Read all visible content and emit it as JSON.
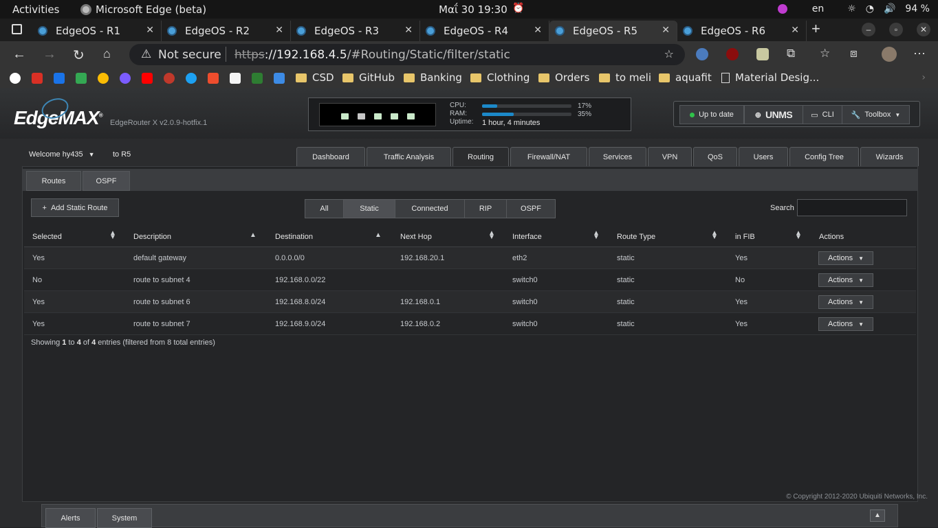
{
  "os_bar": {
    "activities": "Activities",
    "app_name": "Microsoft Edge (beta)",
    "clock": "Μαΐ 30  19:30",
    "lang": "en",
    "battery": "94 %"
  },
  "browser": {
    "tabs": [
      {
        "label": "EdgeOS - R1"
      },
      {
        "label": "EdgeOS - R2"
      },
      {
        "label": "EdgeOS - R3"
      },
      {
        "label": "EdgeOS - R4"
      },
      {
        "label": "EdgeOS - R5",
        "active": true
      },
      {
        "label": "EdgeOS - R6"
      }
    ],
    "not_secure": "Not secure",
    "url_scheme": "https",
    "url_host": "://192.168.4.5",
    "url_path": "/#Routing/Static/filter/static",
    "bookmarks": [
      "CSD",
      "GitHub",
      "Banking",
      "Clothing",
      "Orders",
      "to meli",
      "aquafit",
      "Material Desig..."
    ]
  },
  "router": {
    "logo": "EdgeMAX",
    "model": "EdgeRouter X v2.0.9-hotfix.1",
    "cpu_label": "CPU:",
    "ram_label": "RAM:",
    "uptime_label": "Uptime:",
    "cpu_pct": "17%",
    "cpu_value": 0.17,
    "ram_pct": "35%",
    "ram_value": 0.35,
    "uptime": "1 hour, 4 minutes",
    "update_status": "Up to date",
    "unms": "UNMS",
    "cli": "CLI",
    "toolbox": "Toolbox",
    "welcome": "Welcome hy435",
    "to_router": "to R5",
    "main_tabs": [
      "Dashboard",
      "Traffic Analysis",
      "Routing",
      "Firewall/NAT",
      "Services",
      "VPN",
      "QoS",
      "Users",
      "Config Tree",
      "Wizards"
    ],
    "sub_tabs": [
      "Routes",
      "OSPF"
    ],
    "add_route": "Add Static Route",
    "filters": [
      "All",
      "Static",
      "Connected",
      "RIP",
      "OSPF"
    ],
    "search_label": "Search",
    "columns": [
      "Selected",
      "Description",
      "Destination",
      "Next Hop",
      "Interface",
      "Route Type",
      "in FIB",
      "Actions"
    ],
    "rows": [
      {
        "selected": "Yes",
        "description": "default gateway",
        "destination": "0.0.0.0/0",
        "next_hop": "192.168.20.1",
        "interface": "eth2",
        "route_type": "static",
        "in_fib": "Yes",
        "action": "Actions"
      },
      {
        "selected": "No",
        "description": "route to subnet 4",
        "destination": "192.168.0.0/22",
        "next_hop": "",
        "interface": "switch0",
        "route_type": "static",
        "in_fib": "No",
        "action": "Actions"
      },
      {
        "selected": "Yes",
        "description": "route to subnet 6",
        "destination": "192.168.8.0/24",
        "next_hop": "192.168.0.1",
        "interface": "switch0",
        "route_type": "static",
        "in_fib": "Yes",
        "action": "Actions"
      },
      {
        "selected": "Yes",
        "description": "route to subnet 7",
        "destination": "192.168.9.0/24",
        "next_hop": "192.168.0.2",
        "interface": "switch0",
        "route_type": "static",
        "in_fib": "Yes",
        "action": "Actions"
      }
    ],
    "showing_prefix": "Showing ",
    "showing_from": "1",
    "showing_to_word": " to ",
    "showing_to": "4",
    "showing_of_word": " of ",
    "showing_total": "4",
    "showing_suffix": " entries (filtered from 8 total entries)",
    "copyright": "© Copyright 2012-2020 Ubiquiti Networks, Inc.",
    "footer_tabs": [
      "Alerts",
      "System"
    ]
  }
}
